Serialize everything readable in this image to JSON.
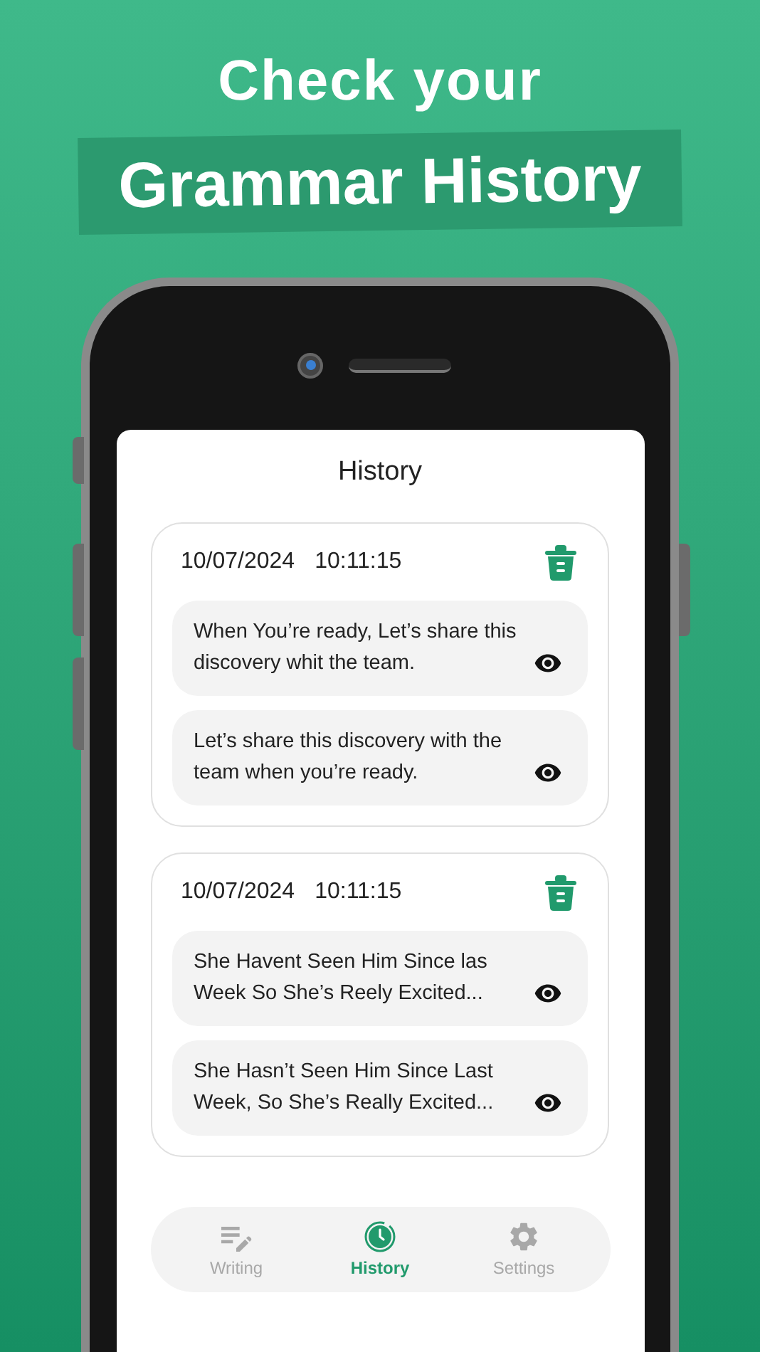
{
  "headline": "Check your",
  "banner": "Grammar History",
  "screen": {
    "title": "History",
    "entries": [
      {
        "date": "10/07/2024",
        "time": "10:11:15",
        "texts": [
          "When You’re ready, Let’s share this discovery whit the team.",
          "Let’s share this discovery with the team when you’re ready."
        ]
      },
      {
        "date": "10/07/2024",
        "time": "10:11:15",
        "texts": [
          "She Havent Seen Him Since las Week So She’s Reely Excited...",
          "She Hasn’t Seen Him Since Last Week, So She’s Really Excited..."
        ]
      }
    ],
    "nav": [
      {
        "kind": "writing",
        "label": "Writing",
        "selected": false
      },
      {
        "kind": "history",
        "label": "History",
        "selected": true
      },
      {
        "kind": "settings",
        "label": "Settings",
        "selected": false
      }
    ]
  }
}
